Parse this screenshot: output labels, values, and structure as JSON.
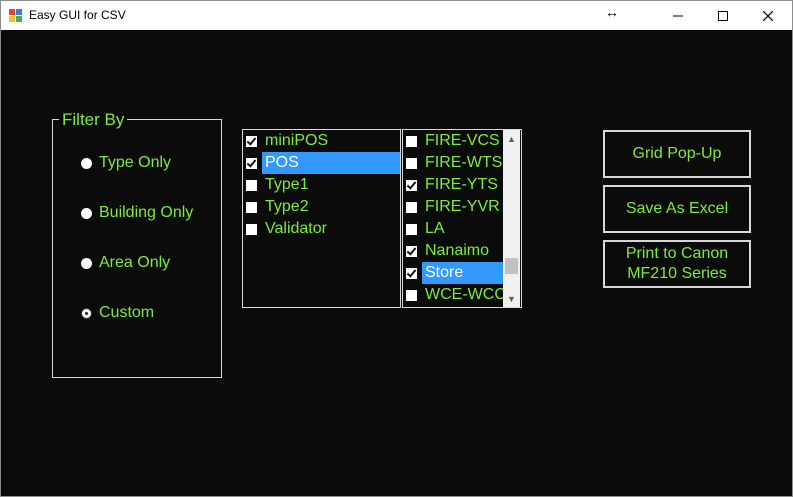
{
  "window": {
    "title": "Easy GUI for CSV",
    "resize_glyph": "↔"
  },
  "colors": {
    "background": "#0c0b0b",
    "text_green": "#7cec34",
    "selection": "#3399ff"
  },
  "filter": {
    "legend": "Filter By",
    "options": [
      {
        "label": "Type Only",
        "checked": false
      },
      {
        "label": "Building Only",
        "checked": false
      },
      {
        "label": "Area Only",
        "checked": false
      },
      {
        "label": "Custom",
        "checked": true
      }
    ]
  },
  "list1": {
    "items": [
      {
        "label": "miniPOS",
        "checked": true,
        "selected": false
      },
      {
        "label": "POS",
        "checked": true,
        "selected": true
      },
      {
        "label": "Type1",
        "checked": false,
        "selected": false
      },
      {
        "label": "Type2",
        "checked": false,
        "selected": false
      },
      {
        "label": "Validator",
        "checked": false,
        "selected": false
      }
    ]
  },
  "list2": {
    "items": [
      {
        "label": "FIRE-VCS",
        "checked": false,
        "selected": false
      },
      {
        "label": "FIRE-WTS",
        "checked": false,
        "selected": false
      },
      {
        "label": "FIRE-YTS",
        "checked": true,
        "selected": false
      },
      {
        "label": "FIRE-YVR",
        "checked": false,
        "selected": false
      },
      {
        "label": "LA",
        "checked": false,
        "selected": false
      },
      {
        "label": "Nanaimo",
        "checked": true,
        "selected": false
      },
      {
        "label": "Store",
        "checked": true,
        "selected": true
      },
      {
        "label": "WCE-WCC",
        "checked": false,
        "selected": false
      }
    ]
  },
  "buttons": {
    "grid_popup": "Grid Pop-Up",
    "save_excel": "Save As Excel",
    "print_canon": "Print to Canon\nMF210 Series"
  }
}
